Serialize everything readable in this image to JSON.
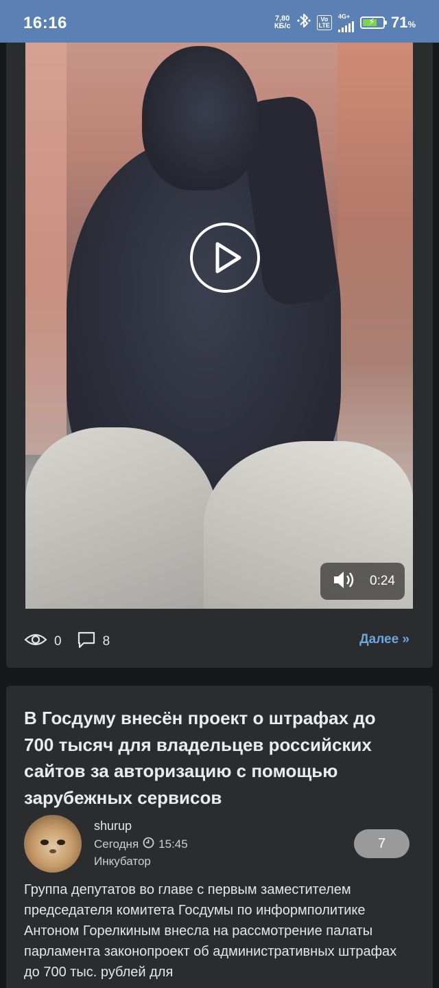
{
  "status_bar": {
    "time": "16:16",
    "net_speed_value": "7,80",
    "net_speed_unit": "КБ/с",
    "volte_top": "Vo",
    "volte_bottom": "LTE",
    "signal_label": "4G+",
    "battery_percent": "71",
    "battery_percent_sign": "%",
    "battery_level": 0.71,
    "icons": [
      "bluetooth-icon",
      "volte-icon",
      "signal-icon",
      "battery-charging-icon"
    ]
  },
  "video_post": {
    "duration": "0:24",
    "views": "0",
    "comments": "8",
    "more_label": "Далее »",
    "icons": [
      "play-icon",
      "volume-icon",
      "eye-icon",
      "comment-icon"
    ]
  },
  "news_post": {
    "title": "В Госдуму внесён проект о штрафах до 700 тысяч для владельцев российских сайтов за авторизацию с помощью зарубежных сервисов",
    "author": "shurup",
    "date": "Сегодня",
    "time": "15:45",
    "category": "Инкубатор",
    "rating": "7",
    "excerpt": "Группа депутатов во главе с первым заместителем председателя комитета Госдумы по информполитике Антоном Горелкиным внесла на рассмотрение палаты парламента законопроект об административных штрафах до 700 тыс. рублей для"
  },
  "colors": {
    "status_bar_bg": "#5b80b3",
    "page_bg": "#171819",
    "card_bg": "#2b2c2e",
    "link": "#6aa6e0",
    "badge_bg": "#9a9a9a"
  }
}
